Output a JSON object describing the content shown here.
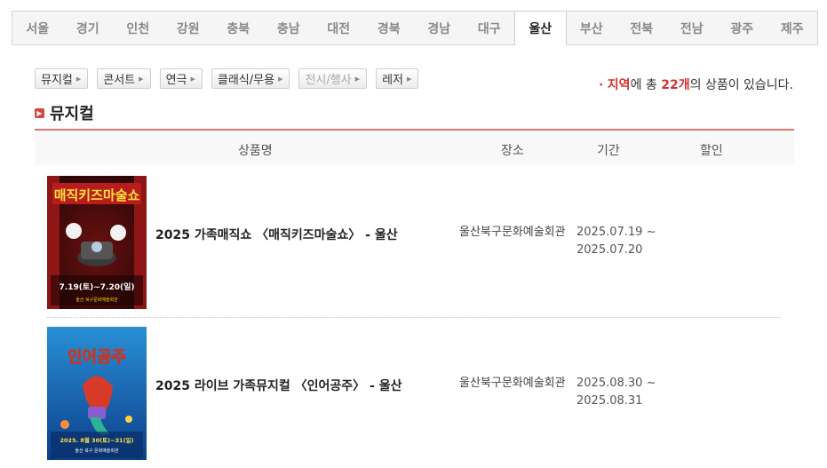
{
  "regions": [
    "서울",
    "경기",
    "인천",
    "강원",
    "충북",
    "충남",
    "대전",
    "경북",
    "경남",
    "대구",
    "울산",
    "부산",
    "전북",
    "전남",
    "광주",
    "제주"
  ],
  "active_region": "울산",
  "categories": [
    {
      "label": "뮤지컬",
      "enabled": true
    },
    {
      "label": "콘서트",
      "enabled": true
    },
    {
      "label": "연극",
      "enabled": true
    },
    {
      "label": "클래식/무용",
      "enabled": true
    },
    {
      "label": "전시/행사",
      "enabled": false
    },
    {
      "label": "레저",
      "enabled": true
    }
  ],
  "result": {
    "bullet": "·",
    "region_word": "지역",
    "mid": "에 총 ",
    "count": "22개",
    "tail": "의 상품이 있습니다."
  },
  "section": {
    "title": "뮤지컬"
  },
  "table": {
    "headers": {
      "name": "상품명",
      "place": "장소",
      "period": "기간",
      "discount": "할인"
    },
    "rows": [
      {
        "title": "2025 가족매직쇼 〈매직키즈마술쇼〉 - 울산",
        "place": "울산북구문화예술회관",
        "period_start": "2025.07.19 ~",
        "period_end": "2025.07.20",
        "poster": {
          "headline": "매직키즈마술쇼",
          "date": "7.19(토)~7.20(일)",
          "venue": "울산 북구문화예술회관"
        }
      },
      {
        "title": "2025 라이브 가족뮤지컬 〈인어공주〉 - 울산",
        "place": "울산북구문화예술회관",
        "period_start": "2025.08.30 ~",
        "period_end": "2025.08.31",
        "poster": {
          "headline": "인어공주",
          "date": "2025. 8월 30(토)~31(일)",
          "venue": "울산 북구 문화예술회관"
        }
      }
    ]
  },
  "colors": {
    "accent": "#d62f2f",
    "header_border": "#d9776f"
  }
}
